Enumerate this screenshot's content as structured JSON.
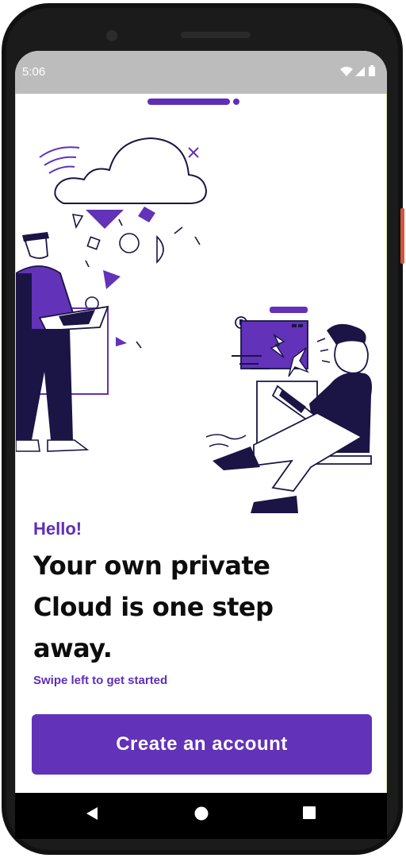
{
  "status_bar": {
    "time": "5:06"
  },
  "onboarding": {
    "greeting": "Hello!",
    "headline": "Your own private Cloud is one step away.",
    "swipe_hint": "Swipe left to get started",
    "create_button_label": "Create an account",
    "pager": {
      "total_pages": 2,
      "current_page": 1
    }
  },
  "navigation": {
    "back_icon": "back-triangle-icon",
    "home_icon": "home-circle-icon",
    "recents_icon": "recents-square-icon"
  },
  "colors": {
    "accent": "#6232b8",
    "headline": "#0d0d0d",
    "status_bar": "#bcbcbc"
  }
}
